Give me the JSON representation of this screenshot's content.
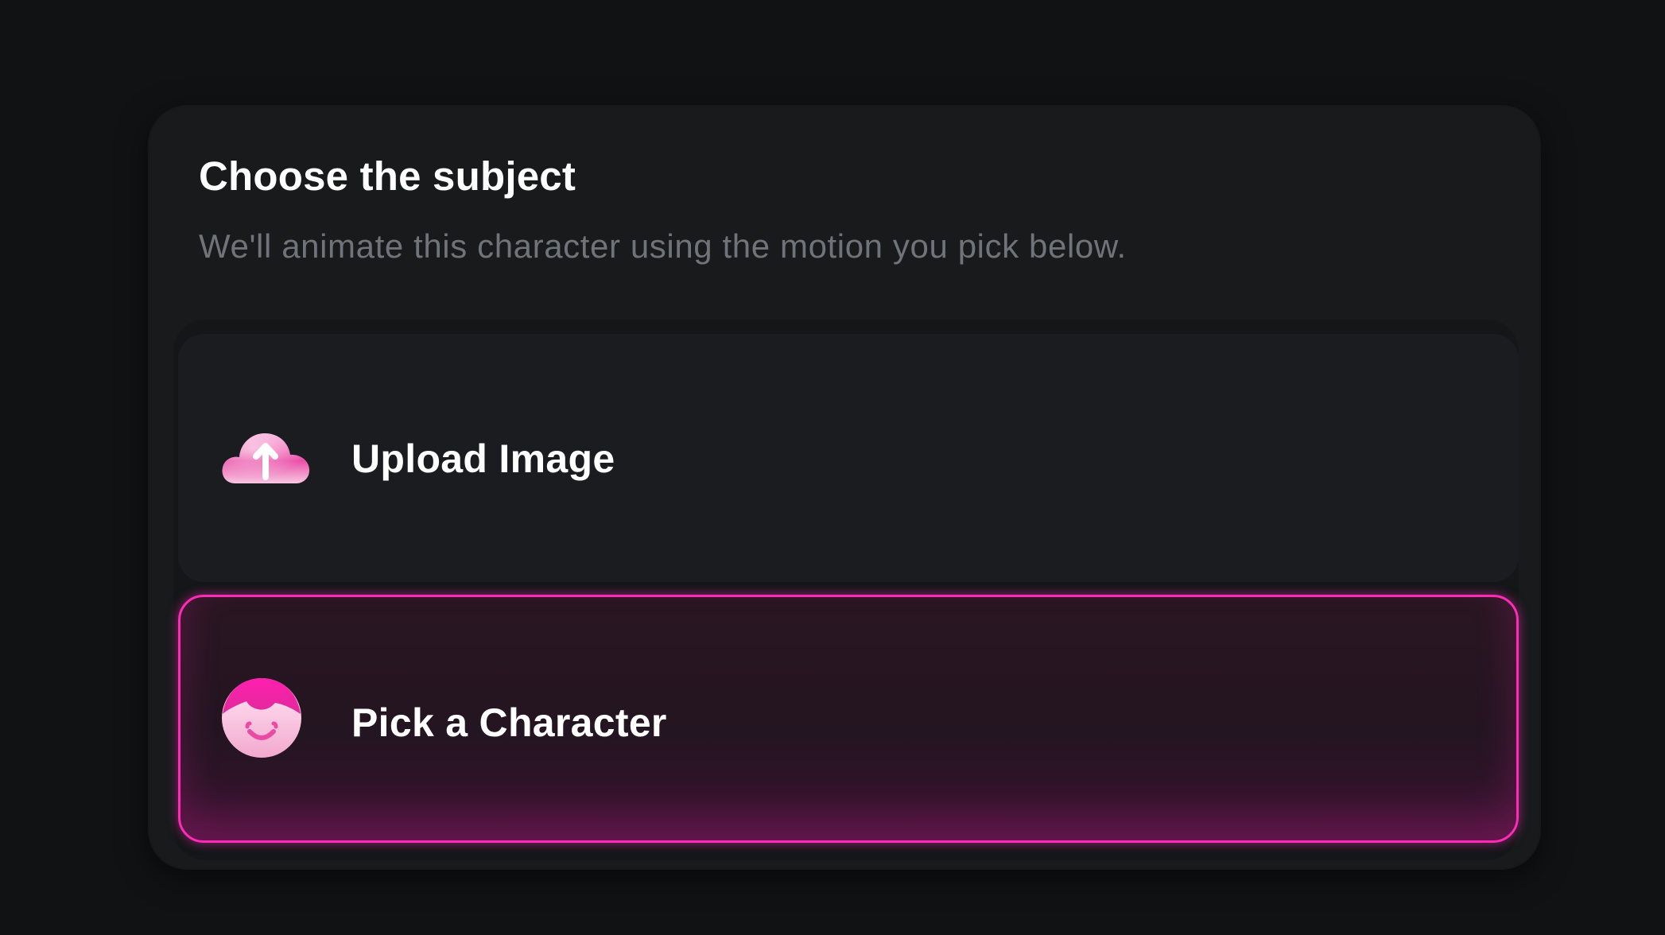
{
  "section": {
    "title": "Choose the subject",
    "subtitle": "We'll animate this character using the motion you pick below."
  },
  "options": [
    {
      "label": "Upload Image",
      "icon": "cloud-upload-icon",
      "selected": false
    },
    {
      "label": "Pick a Character",
      "icon": "character-face-icon",
      "selected": true
    }
  ],
  "colors": {
    "accent": "#ff2bb8",
    "background": "#111213",
    "panel": "#181a1c",
    "subtitle": "#6f737a"
  }
}
